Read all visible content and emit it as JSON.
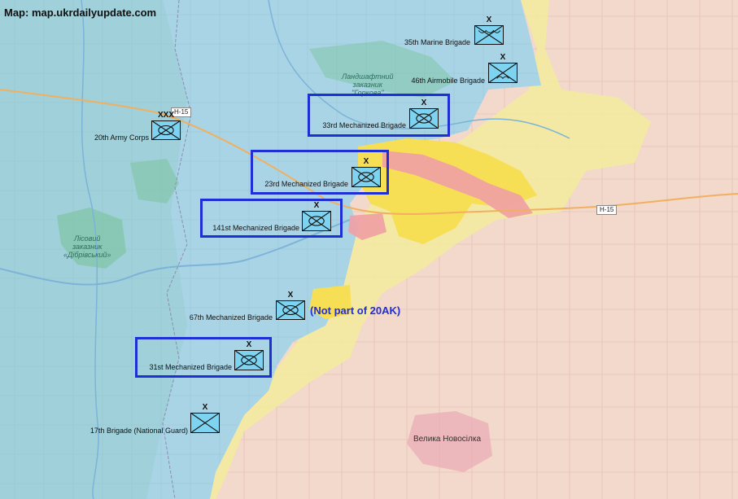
{
  "credit": "Map: map.ukrdailyupdate.com",
  "road_labels": [
    "H-15",
    "H-15"
  ],
  "places": {
    "town": "Велика Новосілка",
    "reserve_east": [
      "Ландшафтний",
      "заказник",
      "\"Горкова\""
    ],
    "reserve_west": [
      "Лісовий",
      "заказник",
      "«Дібрівський»"
    ]
  },
  "note": "(Not part of 20AK)",
  "units": [
    {
      "label": "35th Marine Brigade",
      "echelon": "X",
      "icon": "marine-infantry-icon"
    },
    {
      "label": "46th Airmobile Brigade",
      "echelon": "X",
      "icon": "airmobile-infantry-icon"
    },
    {
      "label": "33rd Mechanized Brigade",
      "echelon": "X",
      "icon": "mechanized-infantry-icon"
    },
    {
      "label": "20th Army Corps",
      "echelon": "XXX",
      "icon": "mechanized-infantry-icon"
    },
    {
      "label": "23rd Mechanized Brigade",
      "echelon": "X",
      "icon": "mechanized-infantry-icon"
    },
    {
      "label": "141st Mechanized Brigade",
      "echelon": "X",
      "icon": "mechanized-infantry-icon"
    },
    {
      "label": "67th Mechanized Brigade",
      "echelon": "X",
      "icon": "mechanized-infantry-icon"
    },
    {
      "label": "31st Mechanized Brigade",
      "echelon": "X",
      "icon": "mechanized-infantry-icon"
    },
    {
      "label": "17th Brigade (National Guard)",
      "echelon": "X",
      "icon": "infantry-icon"
    }
  ],
  "colors": {
    "ukraine_control": "#a9d4e6",
    "russia_control": "#f3d8cc",
    "contested": "#f2ec9c",
    "recent_advance": "#f6de55",
    "highlight_box": "#1f2fd6",
    "unit_fill": "#7dd3f0"
  }
}
